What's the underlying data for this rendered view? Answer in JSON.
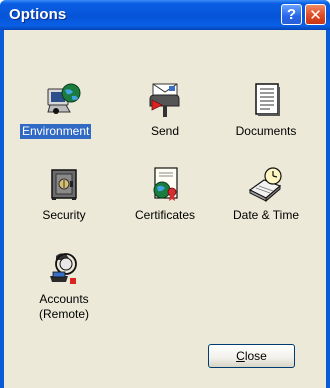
{
  "window": {
    "title": "Options",
    "help_glyph": "?",
    "close_glyph": "✕"
  },
  "items": [
    {
      "label": "Environment",
      "icon": "computer-globe-icon",
      "selected": true
    },
    {
      "label": "Send",
      "icon": "mailbox-icon",
      "selected": false
    },
    {
      "label": "Documents",
      "icon": "document-icon",
      "selected": false
    },
    {
      "label": "Security",
      "icon": "safe-icon",
      "selected": false
    },
    {
      "label": "Certificates",
      "icon": "certificate-icon",
      "selected": false
    },
    {
      "label": "Date & Time",
      "icon": "clock-calendar-icon",
      "selected": false
    },
    {
      "label_line1": "Accounts",
      "label_line2": "(Remote)",
      "icon": "remote-accounts-icon",
      "selected": false
    }
  ],
  "close_button": {
    "mnemonic": "C",
    "rest": "lose"
  },
  "colors": {
    "titlebar": "#0a5ee3",
    "client": "#ece9d8",
    "selection": "#316ac5"
  }
}
